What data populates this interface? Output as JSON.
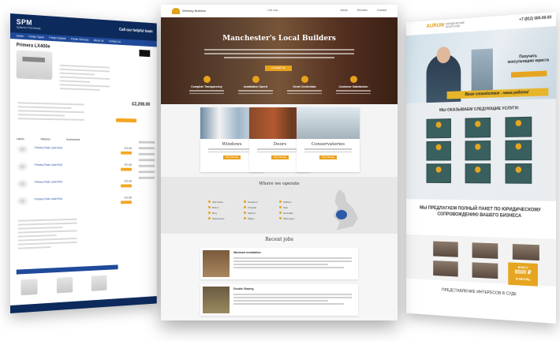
{
  "left_site": {
    "logo": "SPM",
    "tagline": "Systems Print Media",
    "phone": "Call our helpful team",
    "nav": [
      "Home",
      "Printer Types",
      "Printer Models",
      "Printer Services",
      "About Us",
      "Contact Us"
    ],
    "product_title": "Primera LX400e",
    "price": "£2,208.00",
    "tabs": [
      "Labels",
      "Ribbons",
      "Accessories"
    ],
    "rows": [
      {
        "name": "Primera Plain Label Roll",
        "price": "£72.00"
      },
      {
        "name": "Primera Plain Label Roll",
        "price": "£71.00"
      },
      {
        "name": "Primera Plain Label Roll",
        "price": "£72.00"
      },
      {
        "name": "Primera Plain Label Roll",
        "price": "£72.00"
      }
    ],
    "related": "Related Products"
  },
  "center_site": {
    "brand": "Winning Builders",
    "call": "Call now",
    "nav": [
      "About",
      "Services",
      "Contact"
    ],
    "title": "Manchester's Local Builders",
    "hero_button": "Contact Us",
    "features": [
      "Complete Transparency",
      "Installation Speed",
      "Great Credentials",
      "Customer Satisfaction"
    ],
    "cards": [
      {
        "name": "Windows",
        "button": "View Range"
      },
      {
        "name": "Doors",
        "button": "View Range"
      },
      {
        "name": "Conservatories",
        "button": "View Range"
      }
    ],
    "where_title": "Where we operate",
    "towns": [
      "Altrincham",
      "Bolton",
      "Bury",
      "Manchester",
      "Stockport",
      "Cheadle",
      "Salford",
      "Wigan",
      "Oldham",
      "Sale",
      "Rochdale",
      "Warrington"
    ],
    "jobs_title": "Recent jobs",
    "jobs": [
      "Windows Installation",
      "Double Glazing"
    ]
  },
  "right_site": {
    "logo": "AURUM",
    "tagline": "ЮРИДИЧЕСКИЕ АГЕНТСТВО",
    "phone": "+7 (812) 000-00-00",
    "cta": "Получить консультацию юриста",
    "bar": "Ваше спокойствие - наша работа!",
    "services_title": "МЫ ОКАЗЫВАЕМ СЛЕДУЮЩИЕ УСЛУГИ:",
    "tiles": [
      "",
      "",
      "",
      "",
      "",
      "",
      "",
      "",
      ""
    ],
    "offer": "МЫ ПРЕДЛАГАЕМ ПОЛНЫЙ ПАКЕТ ПО ЮРИДИЧЕСКОМУ СОПРОВОЖДЕНИЮ ВАШЕГО БИЗНЕСА",
    "price_top": "ВСЕГО",
    "price": "8500 ₽",
    "price_unit": "В МЕСЯЦ",
    "bottom": "ПРЕДСТАВЛЕНИЕ ИНТЕРЕСОВ В СУДЕ"
  },
  "colors": {
    "spm_navy": "#0d2a5c",
    "accent_orange": "#e8a21c",
    "aurum_teal": "#3a5f5f"
  }
}
